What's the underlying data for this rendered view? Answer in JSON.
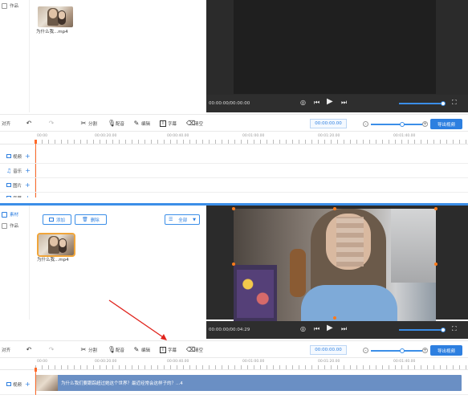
{
  "top": {
    "sidebar": [
      {
        "label": "作品",
        "active": false
      }
    ],
    "thumb_label": "为什么我...mp4",
    "time": "00:00:00/00:00:00",
    "toolbar": {
      "align": "对齐",
      "split": "分割",
      "dub": "配音",
      "edit": "编辑",
      "subtitle": "字幕",
      "clear": "清空",
      "timecode": "00:00:00.00",
      "export": "导出视频"
    },
    "ruler": [
      "00:00",
      "00:00:20.00",
      "00:00:40.00",
      "00:01:00.00",
      "00:01:20.00",
      "00:01:40.00"
    ],
    "tracks": [
      "视频",
      "音乐",
      "图片",
      "字幕"
    ]
  },
  "bottom": {
    "sidebar": [
      {
        "label": "素材",
        "active": true
      },
      {
        "label": "作品",
        "active": false
      }
    ],
    "add_label": "添加",
    "delete_label": "删除",
    "fill_select": "全部",
    "thumb_label": "为什么我...mp4",
    "time": "00:00:00/00:04:29",
    "toolbar": {
      "align": "对齐",
      "split": "分割",
      "dub": "配音",
      "edit": "编辑",
      "subtitle": "字幕",
      "clear": "清空",
      "timecode": "00:00:00.00",
      "export": "导出视频"
    },
    "ruler": [
      "00:00",
      "00:00:20.00",
      "00:00:40.00",
      "00:01:00.00",
      "00:01:20.00",
      "00:01:40.00"
    ],
    "track_video": "视频",
    "clip_label": "为什么我们要跟踪超过她这个世界？最近经常会这样子的？...4"
  },
  "colors": {
    "accent": "#2d7fe0",
    "playhead": "#ff6a2a",
    "arrow": "#e0231c"
  }
}
